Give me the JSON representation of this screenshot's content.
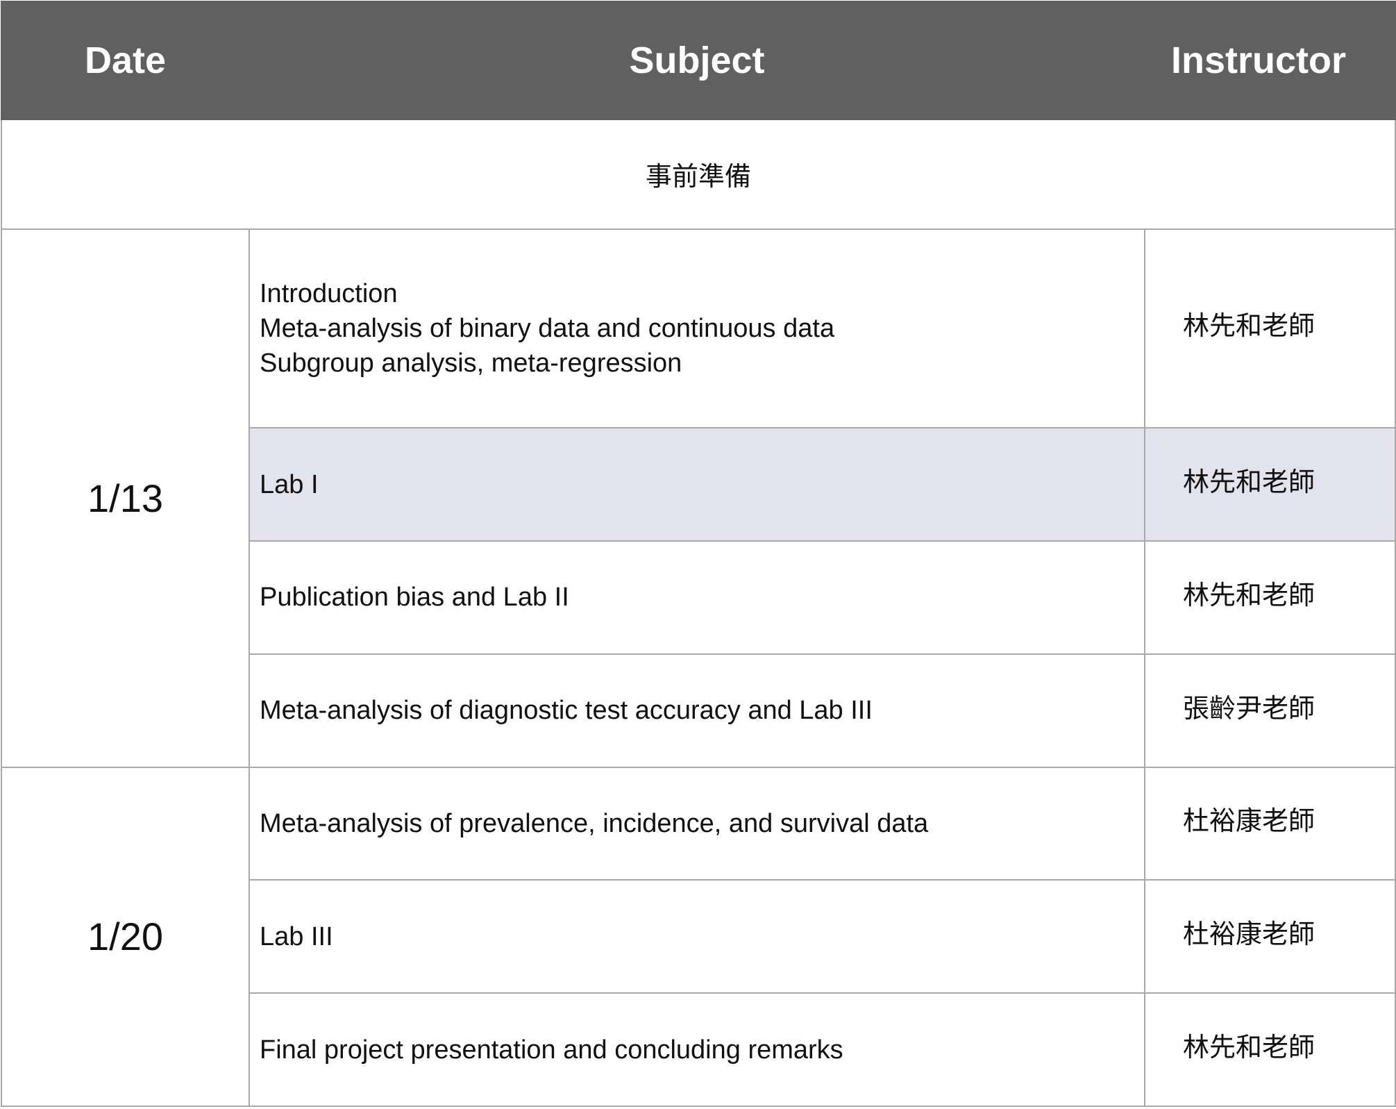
{
  "header": {
    "date": "Date",
    "subject": "Subject",
    "instructor": "Instructor"
  },
  "preparation": "事前準備",
  "sessions": [
    {
      "date": "1/13",
      "rows": [
        {
          "subject_lines": [
            "Introduction",
            "Meta-analysis of binary data and continuous data",
            "Subgroup analysis, meta-regression"
          ],
          "instructor": "林先和老師"
        },
        {
          "subject_lines": [
            "Lab I"
          ],
          "instructor": "林先和老師",
          "highlighted": true
        },
        {
          "subject_lines": [
            "Publication bias and Lab II"
          ],
          "instructor": "林先和老師"
        },
        {
          "subject_lines": [
            "Meta-analysis of diagnostic test accuracy and Lab III"
          ],
          "instructor": "張齡尹老師"
        }
      ]
    },
    {
      "date": "1/20",
      "rows": [
        {
          "subject_lines": [
            "Meta-analysis of prevalence, incidence, and survival data"
          ],
          "instructor": "杜裕康老師"
        },
        {
          "subject_lines": [
            "Lab III"
          ],
          "instructor": "杜裕康老師"
        },
        {
          "subject_lines": [
            "Final project presentation and concluding remarks"
          ],
          "instructor": "林先和老師"
        }
      ]
    }
  ],
  "colors": {
    "header_bg": "#606060",
    "header_text": "#ffffff",
    "highlight_bg": "#e3e3ed",
    "border": "#a9a9a9"
  }
}
